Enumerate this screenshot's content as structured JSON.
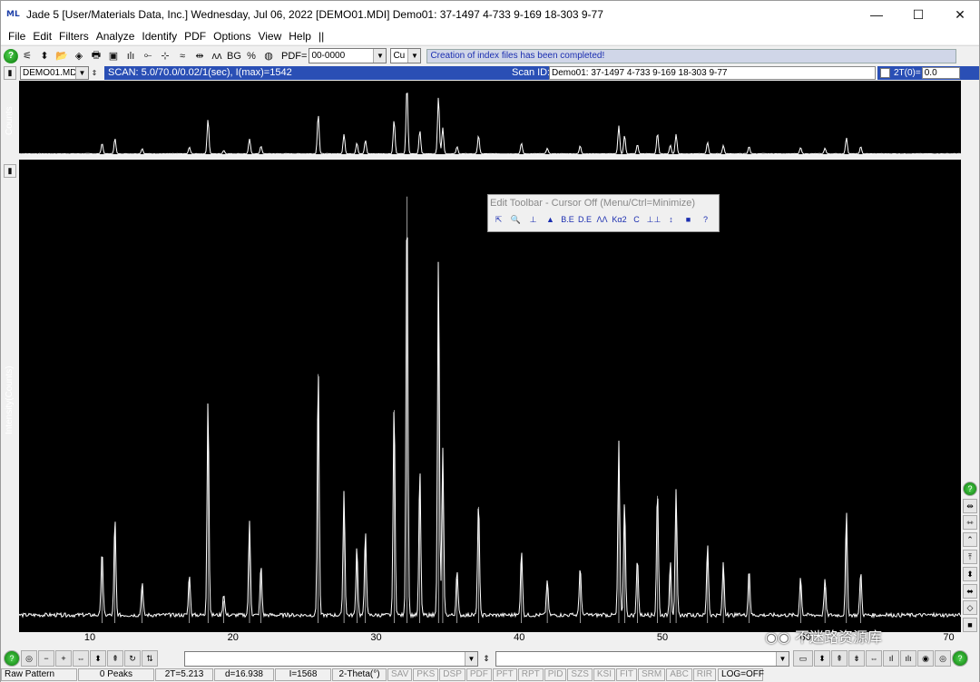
{
  "window": {
    "title": "Jade 5 [User/Materials Data, Inc.] Wednesday, Jul 06, 2022 [DEMO01.MDI] Demo01: 37-1497 4-733 9-169 18-303 9-77",
    "app_icon_text": "ML",
    "min": "—",
    "max": "☐",
    "close": "✕"
  },
  "menu": [
    "File",
    "Edit",
    "Filters",
    "Analyze",
    "Identify",
    "PDF",
    "Options",
    "View",
    "Help",
    "||"
  ],
  "toolbar": {
    "pdf_label": "PDF=",
    "pdf_value": "00-0000",
    "anode_value": "Cu",
    "message": "Creation of index files has been completed!"
  },
  "scanbar": {
    "file": "DEMO01.MDI",
    "scan_info": "SCAN: 5.0/70.0/0.02/1(sec), I(max)=1542",
    "scan_id_label": "Scan ID:",
    "scan_id_value": "Demo01: 37-1497 4-733 9-169 18-303 9-77",
    "two_theta_label": "2T(0)=",
    "two_theta_value": "0.0"
  },
  "plot": {
    "overview_ylabel": "Counts",
    "main_ylabel": "Intensity(Counts)",
    "xticks": [
      "10",
      "20",
      "30",
      "40",
      "50",
      "60",
      "70"
    ]
  },
  "edit_toolbar": {
    "caption": "Edit Toolbar - Cursor Off (Menu/Ctrl=Minimize)",
    "buttons": [
      "⇱",
      "🔍",
      "⊥",
      "▲",
      "B.E",
      "D.E",
      "ΛΛ",
      "Kα2",
      "C",
      "⊥⊥",
      "↕",
      "■",
      "?"
    ]
  },
  "statusbar": {
    "mode": "Raw Pattern",
    "peaks": "0 Peaks",
    "two_theta": "2T=5.213",
    "d": "d=16.938",
    "intensity": "I=1568",
    "axis": "2-Theta(°)",
    "flags": [
      "SAV",
      "PKS",
      "DSP",
      "PDF",
      "PFT",
      "RPT",
      "PID",
      "SZS",
      "KSI",
      "FIT",
      "SRM",
      "ABC",
      "RIR"
    ],
    "log": "LOG=OFF"
  },
  "watermark": "不迷路资源库",
  "chart_data": {
    "type": "line",
    "xlabel": "2-Theta(°)",
    "ylabel": "Intensity(Counts)",
    "xlim": [
      5,
      70
    ],
    "ylim": [
      0,
      1600
    ],
    "peaks": [
      {
        "x": 10.8,
        "y": 240
      },
      {
        "x": 11.7,
        "y": 350
      },
      {
        "x": 13.6,
        "y": 120
      },
      {
        "x": 16.9,
        "y": 150
      },
      {
        "x": 18.2,
        "y": 790
      },
      {
        "x": 19.3,
        "y": 80
      },
      {
        "x": 21.1,
        "y": 340
      },
      {
        "x": 21.9,
        "y": 180
      },
      {
        "x": 25.9,
        "y": 900
      },
      {
        "x": 27.7,
        "y": 450
      },
      {
        "x": 28.6,
        "y": 250
      },
      {
        "x": 29.2,
        "y": 310
      },
      {
        "x": 31.2,
        "y": 770
      },
      {
        "x": 32.1,
        "y": 1542
      },
      {
        "x": 33.0,
        "y": 530
      },
      {
        "x": 34.3,
        "y": 1300
      },
      {
        "x": 34.6,
        "y": 600
      },
      {
        "x": 35.6,
        "y": 160
      },
      {
        "x": 37.1,
        "y": 420
      },
      {
        "x": 40.1,
        "y": 240
      },
      {
        "x": 41.9,
        "y": 130
      },
      {
        "x": 44.2,
        "y": 180
      },
      {
        "x": 46.9,
        "y": 630
      },
      {
        "x": 47.3,
        "y": 420
      },
      {
        "x": 48.2,
        "y": 210
      },
      {
        "x": 49.6,
        "y": 460
      },
      {
        "x": 50.5,
        "y": 200
      },
      {
        "x": 50.9,
        "y": 450
      },
      {
        "x": 53.1,
        "y": 260
      },
      {
        "x": 54.2,
        "y": 190
      },
      {
        "x": 56.0,
        "y": 170
      },
      {
        "x": 59.6,
        "y": 140
      },
      {
        "x": 61.3,
        "y": 130
      },
      {
        "x": 62.8,
        "y": 370
      },
      {
        "x": 63.8,
        "y": 160
      }
    ]
  }
}
